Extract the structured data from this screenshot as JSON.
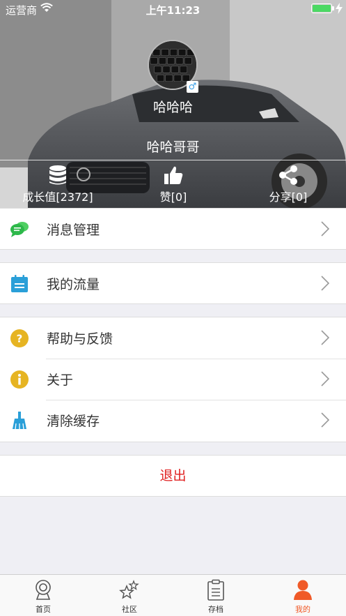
{
  "status_bar": {
    "carrier": "运营商",
    "time": "上午11:23"
  },
  "profile": {
    "nickname": "哈哈哈",
    "gender_symbol": "♂",
    "display_name": "哈哈哥哥"
  },
  "stats": [
    {
      "label": "成长值[2372]",
      "icon": "database-icon"
    },
    {
      "label": "赞[0]",
      "icon": "thumbs-up-icon"
    },
    {
      "label": "分享[0]",
      "icon": "share-icon"
    }
  ],
  "menu": {
    "messages": "消息管理",
    "traffic": "我的流量",
    "help": "帮助与反馈",
    "about": "关于",
    "clear_cache": "清除缓存"
  },
  "logout_label": "退出",
  "tabs": [
    {
      "label": "首页",
      "icon": "webcam-icon"
    },
    {
      "label": "社区",
      "icon": "stars-icon"
    },
    {
      "label": "存档",
      "icon": "clipboard-icon"
    },
    {
      "label": "我的",
      "icon": "user-icon",
      "active": true
    }
  ],
  "colors": {
    "accent": "#f05a28",
    "logout": "#e02020",
    "messages_icon": "#2db84a",
    "traffic_icon": "#2a9fd8",
    "help_icon": "#e6b422",
    "about_icon": "#e6b422",
    "clear_icon": "#2a9fd8",
    "battery": "#4cd964"
  }
}
